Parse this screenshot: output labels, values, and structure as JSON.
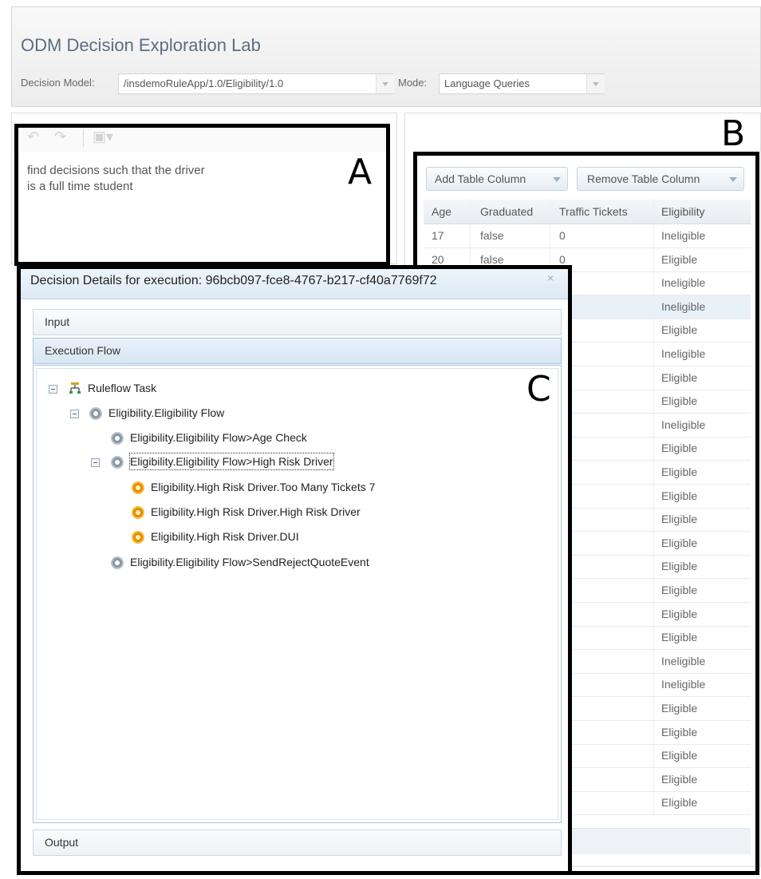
{
  "header": {
    "title": "ODM Decision Exploration Lab",
    "decision_model_label": "Decision Model:",
    "decision_model_value": "/insdemoRuleApp/1.0/Eligibility/1.0",
    "mode_label": "Mode:",
    "mode_value": "Language Queries"
  },
  "annotations": {
    "a": "A",
    "b": "B",
    "c": "C"
  },
  "query": {
    "text": "find decisions such that the driver\nis a full time student"
  },
  "table": {
    "add_column_label": "Add Table Column",
    "remove_column_label": "Remove Table Column",
    "columns": [
      "Age",
      "Graduated",
      "Traffic Tickets",
      "Eligibility"
    ],
    "rows": [
      [
        "17",
        "false",
        "0",
        "Ineligible"
      ],
      [
        "20",
        "false",
        "0",
        "Eligible"
      ],
      [
        "",
        "",
        "",
        "Ineligible"
      ],
      [
        "",
        "",
        "",
        "Ineligible"
      ],
      [
        "",
        "",
        "",
        "Eligible"
      ],
      [
        "",
        "",
        "",
        "Ineligible"
      ],
      [
        "",
        "",
        "",
        "Eligible"
      ],
      [
        "",
        "",
        "",
        "Eligible"
      ],
      [
        "",
        "",
        "",
        "Ineligible"
      ],
      [
        "",
        "",
        "",
        "Eligible"
      ],
      [
        "",
        "",
        "",
        "Eligible"
      ],
      [
        "",
        "",
        "",
        "Eligible"
      ],
      [
        "",
        "",
        "",
        "Eligible"
      ],
      [
        "",
        "",
        "",
        "Eligible"
      ],
      [
        "",
        "",
        "",
        "Eligible"
      ],
      [
        "",
        "",
        "",
        "Eligible"
      ],
      [
        "",
        "",
        "",
        "Eligible"
      ],
      [
        "",
        "",
        "",
        "Eligible"
      ],
      [
        "",
        "",
        "",
        "Ineligible"
      ],
      [
        "",
        "",
        "",
        "Ineligible"
      ],
      [
        "",
        "",
        "",
        "Eligible"
      ],
      [
        "",
        "",
        "",
        "Eligible"
      ],
      [
        "",
        "",
        "",
        "Eligible"
      ],
      [
        "",
        "",
        "",
        "Eligible"
      ],
      [
        "",
        "",
        "",
        "Eligible"
      ]
    ],
    "selected_row_index": 3
  },
  "dialog": {
    "title": "Decision Details for execution: 96bcb097-fce8-4767-b217-cf40a7769f72",
    "close_glyph": "×",
    "sections": {
      "input": "Input",
      "execution_flow": "Execution Flow",
      "output": "Output"
    },
    "tree": [
      "Ruleflow Task",
      "Eligibility.Eligibility Flow",
      "Eligibility.Eligibility Flow>Age Check",
      "Eligibility.Eligibility Flow>High Risk Driver",
      "Eligibility.High Risk Driver.Too Many Tickets 7",
      "Eligibility.High Risk Driver.High Risk Driver",
      "Eligibility.High Risk Driver.DUI",
      "Eligibility.Eligibility Flow>SendRejectQuoteEvent"
    ]
  },
  "icons": {
    "undo": "undo-icon",
    "redo": "redo-icon",
    "query-menu": "query-menu-icon",
    "ruleflow": "ruleflow-icon",
    "gear": "gear-icon",
    "rule": "rule-icon"
  }
}
